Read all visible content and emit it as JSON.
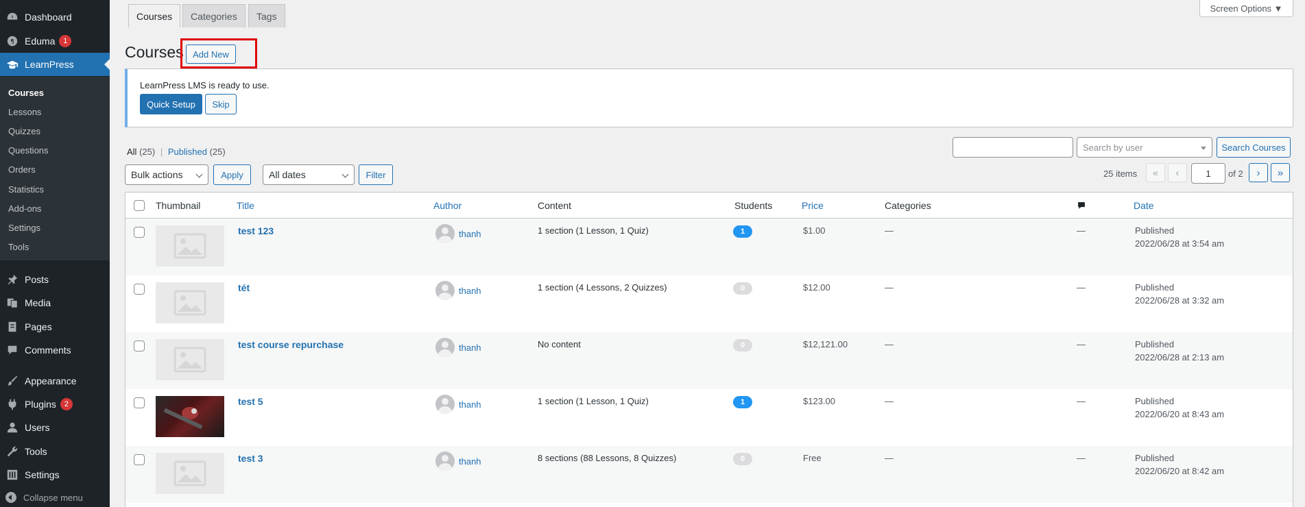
{
  "sidebar": {
    "menu": [
      {
        "label": "Dashboard",
        "icon": "dashboard-icon"
      },
      {
        "label": "Eduma",
        "icon": "eduma-icon",
        "badge": "1"
      },
      {
        "label": "LearnPress",
        "icon": "learnpress-icon"
      },
      {
        "label": "Posts",
        "icon": "pin-icon"
      },
      {
        "label": "Media",
        "icon": "media-icon"
      },
      {
        "label": "Pages",
        "icon": "pages-icon"
      },
      {
        "label": "Comments",
        "icon": "comments-icon"
      },
      {
        "label": "Appearance",
        "icon": "brush-icon"
      },
      {
        "label": "Plugins",
        "icon": "plugin-icon",
        "badge": "2"
      },
      {
        "label": "Users",
        "icon": "users-icon"
      },
      {
        "label": "Tools",
        "icon": "wrench-icon"
      },
      {
        "label": "Settings",
        "icon": "settings-icon"
      }
    ],
    "submenu": [
      "Courses",
      "Lessons",
      "Quizzes",
      "Questions",
      "Orders",
      "Statistics",
      "Add-ons",
      "Settings",
      "Tools"
    ],
    "collapse_label": "Collapse menu"
  },
  "tabs": [
    "Courses",
    "Categories",
    "Tags"
  ],
  "screen_options": "Screen Options ▼",
  "page_title": "Courses",
  "add_new": "Add New",
  "notice": {
    "text": "LearnPress LMS is ready to use.",
    "quick_setup": "Quick Setup",
    "skip": "Skip"
  },
  "filters": {
    "all_label": "All",
    "all_count": "(25)",
    "separator": "|",
    "published_label": "Published",
    "published_count": "(25)",
    "search_user_placeholder": "Search by user",
    "search_button": "Search Courses",
    "bulk_actions": "Bulk actions",
    "apply": "Apply",
    "dates": "All dates",
    "filter": "Filter",
    "items_count": "25 items",
    "current_page": "1",
    "of_pages": "of 2",
    "first": "«",
    "prev": "‹",
    "next": "›",
    "last": "»"
  },
  "table": {
    "headers": {
      "thumbnail": "Thumbnail",
      "title": "Title",
      "author": "Author",
      "content": "Content",
      "students": "Students",
      "price": "Price",
      "categories": "Categories",
      "date": "Date"
    },
    "rows": [
      {
        "title": "test 123",
        "author": "thanh",
        "content": "1 section (1 Lesson, 1 Quiz)",
        "students": "1",
        "price": "$1.00",
        "categories": "—",
        "comments": "—",
        "status": "Published",
        "date": "2022/06/28 at 3:54 am",
        "thumb": "placeholder"
      },
      {
        "title": "tét",
        "author": "thanh",
        "content": "1 section (4 Lessons, 2 Quizzes)",
        "students": "0",
        "price": "$12.00",
        "categories": "—",
        "comments": "—",
        "status": "Published",
        "date": "2022/06/28 at 3:32 am",
        "thumb": "placeholder"
      },
      {
        "title": "test course repurchase",
        "author": "thanh",
        "content": "No content",
        "students": "0",
        "price": "$12,121.00",
        "categories": "—",
        "comments": "—",
        "status": "Published",
        "date": "2022/06/28 at 2:13 am",
        "thumb": "placeholder"
      },
      {
        "title": "test 5",
        "author": "thanh",
        "content": "1 section (1 Lesson, 1 Quiz)",
        "students": "1",
        "price": "$123.00",
        "categories": "—",
        "comments": "—",
        "status": "Published",
        "date": "2022/06/20 at 8:43 am",
        "thumb": "photo"
      },
      {
        "title": "test 3",
        "author": "thanh",
        "content": "8 sections (88 Lessons, 8 Quizzes)",
        "students": "0",
        "price": "Free",
        "categories": "—",
        "comments": "—",
        "status": "Published",
        "date": "2022/06/20 at 8:42 am",
        "thumb": "placeholder"
      }
    ]
  },
  "colors": {
    "accent": "#2271b1",
    "badge_active": "#2196f3",
    "badge_zero": "#dcdcde",
    "highlight": "#e00000"
  }
}
